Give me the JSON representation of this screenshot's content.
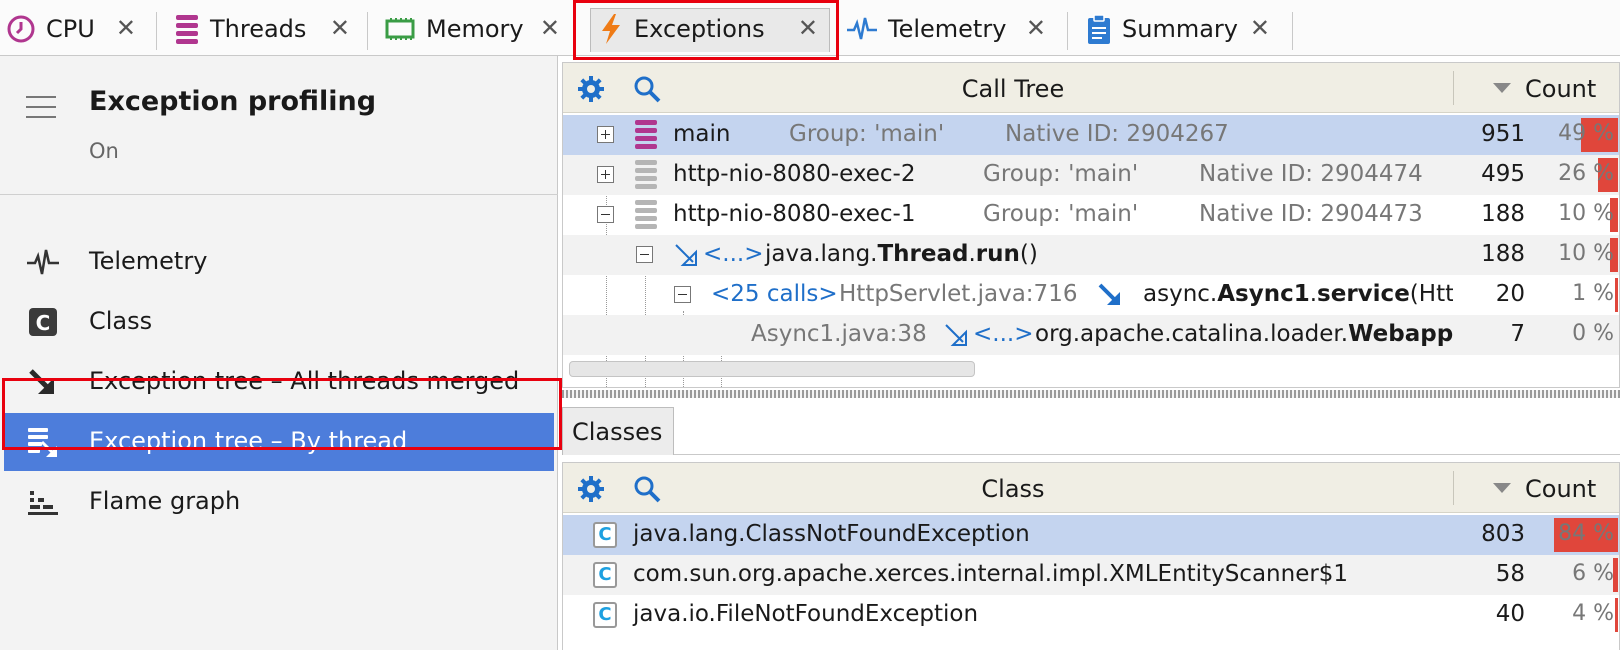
{
  "tabs": [
    {
      "label": "CPU",
      "icon": "clock-icon",
      "close": "✕"
    },
    {
      "label": "Threads",
      "icon": "threads-icon",
      "close": "✕"
    },
    {
      "label": "Memory",
      "icon": "memory-chip-icon",
      "close": "✕"
    },
    {
      "label": "Exceptions",
      "icon": "lightning-icon",
      "close": "✕",
      "active": true
    },
    {
      "label": "Telemetry",
      "icon": "pulse-icon",
      "close": "✕"
    },
    {
      "label": "Summary",
      "icon": "clipboard-icon",
      "close": "✕"
    }
  ],
  "sidebar": {
    "title": "Exception profiling",
    "status": "On",
    "items": [
      {
        "label": "Telemetry",
        "icon": "pulse-icon"
      },
      {
        "label": "Class",
        "icon": "class-c-icon"
      },
      {
        "label": "Exception tree – All threads merged",
        "icon": "arrow-down-right-icon"
      },
      {
        "label": "Exception tree – By thread",
        "icon": "thread-tree-icon",
        "selected": true
      },
      {
        "label": "Flame graph",
        "icon": "flame-graph-icon"
      }
    ]
  },
  "call_tree": {
    "title": "Call Tree",
    "count_header": "Count",
    "rows": [
      {
        "name": "main",
        "group": "Group: 'main'",
        "native": "Native ID: 2904267",
        "count": "951",
        "pct": "49 %",
        "share": 0.49
      },
      {
        "name": "http-nio-8080-exec-2",
        "group": "Group: 'main'",
        "native": "Native ID: 2904474",
        "count": "495",
        "pct": "26 %",
        "share": 0.26
      },
      {
        "name": "http-nio-8080-exec-1",
        "group": "Group: 'main'",
        "native": "Native ID: 2904473",
        "count": "188",
        "pct": "10 %",
        "share": 0.1
      },
      {
        "prefix": "<...>",
        "pkg": "java.lang.",
        "cls": "Thread",
        "method": "run",
        "suffix": "()",
        "count": "188",
        "pct": "10 %",
        "share": 0.1
      },
      {
        "calls": "<25 calls>",
        "loc": "HttpServlet.java:716",
        "pkg": "async.",
        "cls": "Async1",
        "method": "service",
        "suffix": "(Htt",
        "count": "20",
        "pct": "1 %",
        "share": 0.01
      },
      {
        "loc": "Async1.java:38",
        "prefix": "<...>",
        "pkg": "org.apache.catalina.loader.",
        "cls": "Webapp",
        "count": "7",
        "pct": "0 %",
        "share": 0.0
      }
    ]
  },
  "classes_tab": {
    "label": "Classes"
  },
  "class_table": {
    "title": "Class",
    "count_header": "Count",
    "rows": [
      {
        "name": "java.lang.ClassNotFoundException",
        "count": "803",
        "pct": "84 %",
        "share": 0.84
      },
      {
        "name": "com.sun.org.apache.xerces.internal.impl.XMLEntityScanner$1",
        "count": "58",
        "pct": "6 %",
        "share": 0.06
      },
      {
        "name": "java.io.FileNotFoundException",
        "count": "40",
        "pct": "4 %",
        "share": 0.04
      }
    ]
  },
  "colors": {
    "accent": "#4d7ddb",
    "highlight_frame": "#e8000e",
    "bar": "#e0463b",
    "row_selected": "#c4d4ef",
    "header_bg": "#f0eee4"
  }
}
